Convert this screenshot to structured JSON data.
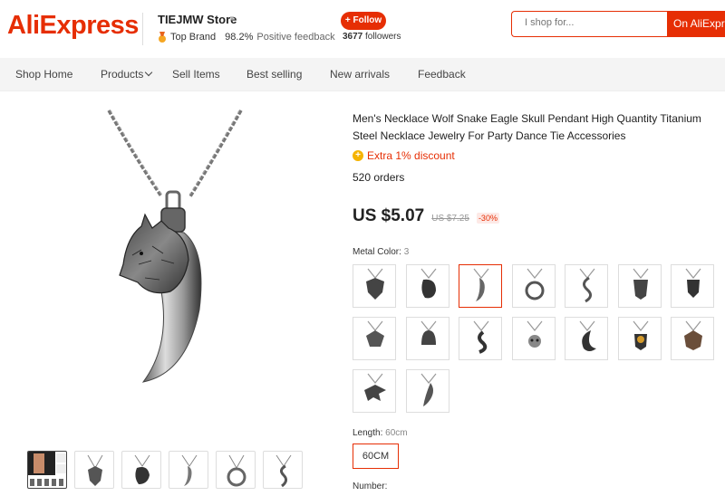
{
  "header": {
    "logo": "AliExpress",
    "store_name": "TIEJMW Store",
    "top_brand": "Top Brand",
    "feedback_pct": "98.2%",
    "feedback_label": "Positive feedback",
    "follow_label": "+ Follow",
    "followers_count": "3677",
    "followers_label": "followers",
    "search_placeholder": "I shop for...",
    "search_button": "On AliExpress"
  },
  "nav": {
    "items": [
      "Shop Home",
      "Products",
      "Sell Items",
      "Best selling",
      "New arrivals",
      "Feedback"
    ]
  },
  "product": {
    "title": "Men's Necklace Wolf Snake Eagle Skull Pendant High Quantity Titanium Steel Necklace Jewelry For Party Dance Tie Accessories",
    "discount": "Extra 1% discount",
    "orders": "520 orders",
    "price": "US $5.07",
    "original_price": "US $7.25",
    "discount_pct": "-30%",
    "metal_color_label": "Metal Color:",
    "metal_color_value": "3",
    "length_label": "Length:",
    "length_value": "60cm",
    "length_option": "60CM",
    "number_label": "Number:"
  },
  "colors": {
    "brand": "#e62e04",
    "nav_bg": "#f4f4f4"
  },
  "sku_icons": [
    "wolf-head-pendant-icon",
    "skull-eagle-pendant-icon",
    "wolf-tooth-pendant-icon",
    "moon-wolf-pendant-icon",
    "snake-pendant-icon",
    "owl-pendant-icon",
    "wolf-face-pendant-icon",
    "tiger-head-pendant-icon",
    "helmet-pendant-icon",
    "serpent-pendant-icon",
    "skull-pendant-icon",
    "crescent-moon-pendant-icon",
    "gold-skull-pendant-icon",
    "lion-head-pendant-icon",
    "eagle-pendant-icon",
    "feather-pendant-icon"
  ]
}
